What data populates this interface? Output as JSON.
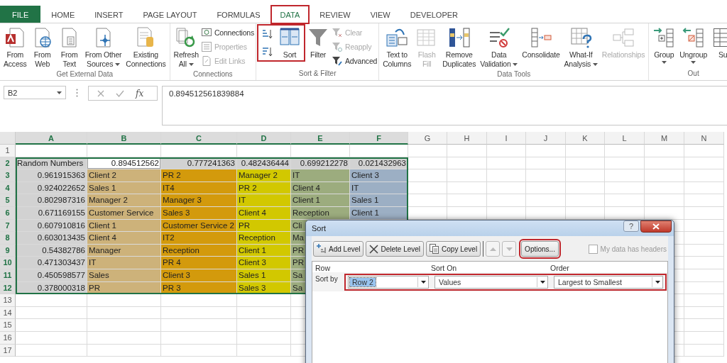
{
  "ribbon_tabs": [
    {
      "label": "FILE",
      "kind": "file",
      "selected": false,
      "highlighted": false
    },
    {
      "label": "HOME",
      "kind": "tab",
      "selected": false,
      "highlighted": false
    },
    {
      "label": "INSERT",
      "kind": "tab",
      "selected": false,
      "highlighted": false
    },
    {
      "label": "PAGE LAYOUT",
      "kind": "tab",
      "selected": false,
      "highlighted": false
    },
    {
      "label": "FORMULAS",
      "kind": "tab",
      "selected": false,
      "highlighted": false
    },
    {
      "label": "DATA",
      "kind": "tab",
      "selected": true,
      "highlighted": true
    },
    {
      "label": "REVIEW",
      "kind": "tab",
      "selected": false,
      "highlighted": false
    },
    {
      "label": "VIEW",
      "kind": "tab",
      "selected": false,
      "highlighted": false
    },
    {
      "label": "DEVELOPER",
      "kind": "tab",
      "selected": false,
      "highlighted": false
    }
  ],
  "ribbon": {
    "groups": [
      {
        "label": "Get External Data",
        "items": [
          {
            "kind": "large",
            "lines": [
              "From",
              "Access"
            ],
            "dropdown": false,
            "disabled": false
          },
          {
            "kind": "large",
            "lines": [
              "From",
              "Web"
            ],
            "dropdown": false,
            "disabled": false
          },
          {
            "kind": "large",
            "lines": [
              "From",
              "Text"
            ],
            "dropdown": false,
            "disabled": false
          },
          {
            "kind": "large",
            "lines": [
              "From Other",
              "Sources"
            ],
            "dropdown": true,
            "disabled": false
          },
          {
            "kind": "large",
            "lines": [
              "Existing",
              "Connections"
            ],
            "dropdown": false,
            "disabled": false
          }
        ]
      },
      {
        "label": "Connections",
        "items": [
          {
            "kind": "large",
            "lines": [
              "Refresh",
              "All"
            ],
            "dropdown": true,
            "disabled": false
          },
          {
            "kind": "stack",
            "items": [
              {
                "kind": "small",
                "label": "Connections",
                "disabled": false
              },
              {
                "kind": "small",
                "label": "Properties",
                "disabled": true
              },
              {
                "kind": "small",
                "label": "Edit Links",
                "disabled": true
              }
            ]
          }
        ]
      },
      {
        "label": "Sort & Filter",
        "items": [
          {
            "kind": "cluster",
            "highlighted": true,
            "items": [
              {
                "kind": "stack",
                "items": [
                  {
                    "kind": "icon",
                    "disabled": false
                  },
                  {
                    "kind": "icon",
                    "disabled": false
                  }
                ]
              },
              {
                "kind": "large",
                "lines": [
                  "Sort"
                ],
                "dropdown": false,
                "disabled": false
              }
            ]
          },
          {
            "kind": "large",
            "lines": [
              "Filter"
            ],
            "dropdown": false,
            "disabled": false
          },
          {
            "kind": "stack",
            "items": [
              {
                "kind": "small",
                "label": "Clear",
                "disabled": true
              },
              {
                "kind": "small",
                "label": "Reapply",
                "disabled": true
              },
              {
                "kind": "small",
                "label": "Advanced",
                "disabled": false
              }
            ]
          }
        ]
      },
      {
        "label": "Data Tools",
        "items": [
          {
            "kind": "large",
            "lines": [
              "Text to",
              "Columns"
            ],
            "dropdown": false,
            "disabled": false
          },
          {
            "kind": "large",
            "lines": [
              "Flash",
              "Fill"
            ],
            "dropdown": false,
            "disabled": true
          },
          {
            "kind": "large",
            "lines": [
              "Remove",
              "Duplicates"
            ],
            "dropdown": false,
            "disabled": false
          },
          {
            "kind": "large",
            "lines": [
              "Data",
              "Validation"
            ],
            "dropdown": true,
            "disabled": false
          },
          {
            "kind": "large",
            "lines": [
              "Consolidate"
            ],
            "dropdown": false,
            "disabled": false
          },
          {
            "kind": "large",
            "lines": [
              "What-If",
              "Analysis"
            ],
            "dropdown": true,
            "disabled": false
          },
          {
            "kind": "large",
            "lines": [
              "Relationships"
            ],
            "dropdown": false,
            "disabled": true
          }
        ]
      },
      {
        "label": "Out",
        "items": [
          {
            "kind": "large",
            "lines": [
              "Group"
            ],
            "dropdown": true,
            "disabled": false
          },
          {
            "kind": "large",
            "lines": [
              "Ungroup"
            ],
            "dropdown": true,
            "disabled": false
          },
          {
            "kind": "large",
            "lines": [
              "Su"
            ],
            "dropdown": false,
            "disabled": false
          }
        ]
      }
    ]
  },
  "formula_bar": {
    "name_box": "B2",
    "insert_function": "fx",
    "formula": "0.894512561839884"
  },
  "sheet": {
    "columns": [
      "A",
      "B",
      "C",
      "D",
      "E",
      "F",
      "G",
      "H",
      "I",
      "J",
      "K",
      "L",
      "M",
      "N"
    ],
    "rows": [
      {
        "label": "1",
        "cells": []
      },
      {
        "label": "2",
        "cells": [
          {
            "text": "Random Numbers",
            "kind": "text",
            "color": "#d2d2d2",
            "selected": false
          },
          {
            "text": "0.894512562",
            "kind": "number",
            "selected": true
          },
          {
            "text": "0.777241363",
            "kind": "number",
            "color": "#d2d2d2",
            "selected": false
          },
          {
            "text": "0.482436444",
            "kind": "number",
            "color": "#d2d2d2",
            "selected": false
          },
          {
            "text": "0.699212278",
            "kind": "number",
            "color": "#d2d2d2",
            "selected": false
          },
          {
            "text": "0.021432963",
            "kind": "number",
            "color": "#d2d2d2",
            "selected": false
          }
        ]
      },
      {
        "label": "3",
        "cells": [
          {
            "text": "0.961915363",
            "kind": "number",
            "color": "#d2d2d2",
            "selected": false
          },
          {
            "text": "Client 2",
            "kind": "text",
            "color": "#cdb27a",
            "selected": false
          },
          {
            "text": "PR 2",
            "kind": "text",
            "color": "#d39a0c",
            "selected": false
          },
          {
            "text": "Manager 2",
            "kind": "text",
            "color": "#d2c800",
            "selected": false
          },
          {
            "text": "IT",
            "kind": "text",
            "color": "#9cac7e",
            "selected": false
          },
          {
            "text": "Client 3",
            "kind": "text",
            "color": "#9cafc4",
            "selected": false
          }
        ]
      },
      {
        "label": "4",
        "cells": [
          {
            "text": "0.924022652",
            "kind": "number",
            "color": "#d2d2d2",
            "selected": false
          },
          {
            "text": "Sales 1",
            "kind": "text",
            "color": "#cdb27a",
            "selected": false
          },
          {
            "text": "IT4",
            "kind": "text",
            "color": "#d39a0c",
            "selected": false
          },
          {
            "text": "PR 2",
            "kind": "text",
            "color": "#d2c800",
            "selected": false
          },
          {
            "text": "Client 4",
            "kind": "text",
            "color": "#9cac7e",
            "selected": false
          },
          {
            "text": "IT",
            "kind": "text",
            "color": "#9cafc4",
            "selected": false
          }
        ]
      },
      {
        "label": "5",
        "cells": [
          {
            "text": "0.802987316",
            "kind": "number",
            "color": "#d2d2d2",
            "selected": false
          },
          {
            "text": "Manager 2",
            "kind": "text",
            "color": "#cdb27a",
            "selected": false
          },
          {
            "text": "Manager 3",
            "kind": "text",
            "color": "#d39a0c",
            "selected": false
          },
          {
            "text": "IT",
            "kind": "text",
            "color": "#d2c800",
            "selected": false
          },
          {
            "text": "Client 1",
            "kind": "text",
            "color": "#9cac7e",
            "selected": false
          },
          {
            "text": "Sales 1",
            "kind": "text",
            "color": "#9cafc4",
            "selected": false
          }
        ]
      },
      {
        "label": "6",
        "cells": [
          {
            "text": "0.671169155",
            "kind": "number",
            "color": "#d2d2d2",
            "selected": false
          },
          {
            "text": "Customer Service",
            "kind": "text",
            "color": "#cdb27a",
            "selected": false
          },
          {
            "text": "Sales 3",
            "kind": "text",
            "color": "#d39a0c",
            "selected": false
          },
          {
            "text": "Client 4",
            "kind": "text",
            "color": "#d2c800",
            "selected": false
          },
          {
            "text": "Reception",
            "kind": "text",
            "color": "#9cac7e",
            "selected": false
          },
          {
            "text": "Client 1",
            "kind": "text",
            "color": "#9cafc4",
            "selected": false
          }
        ]
      },
      {
        "label": "7",
        "cells": [
          {
            "text": "0.607910816",
            "kind": "number",
            "color": "#d2d2d2",
            "selected": false
          },
          {
            "text": "Client 1",
            "kind": "text",
            "color": "#cdb27a",
            "selected": false
          },
          {
            "text": "Customer Service 2",
            "kind": "text",
            "color": "#d39a0c",
            "selected": false
          },
          {
            "text": "PR",
            "kind": "text",
            "color": "#d2c800",
            "selected": false
          },
          {
            "text": "Cli",
            "kind": "text",
            "color": "#9cac7e",
            "selected": false
          }
        ]
      },
      {
        "label": "8",
        "cells": [
          {
            "text": "0.603013435",
            "kind": "number",
            "color": "#d2d2d2",
            "selected": false
          },
          {
            "text": "Client 4",
            "kind": "text",
            "color": "#cdb27a",
            "selected": false
          },
          {
            "text": "IT2",
            "kind": "text",
            "color": "#d39a0c",
            "selected": false
          },
          {
            "text": "Reception",
            "kind": "text",
            "color": "#d2c800",
            "selected": false
          },
          {
            "text": "Ma",
            "kind": "text",
            "color": "#9cac7e",
            "selected": false
          }
        ]
      },
      {
        "label": "9",
        "cells": [
          {
            "text": "0.54382786",
            "kind": "number",
            "color": "#d2d2d2",
            "selected": false
          },
          {
            "text": "Manager",
            "kind": "text",
            "color": "#cdb27a",
            "selected": false
          },
          {
            "text": "Reception",
            "kind": "text",
            "color": "#d39a0c",
            "selected": false
          },
          {
            "text": "Client 1",
            "kind": "text",
            "color": "#d2c800",
            "selected": false
          },
          {
            "text": "PR",
            "kind": "text",
            "color": "#9cac7e",
            "selected": false
          }
        ]
      },
      {
        "label": "10",
        "cells": [
          {
            "text": "0.471303437",
            "kind": "number",
            "color": "#d2d2d2",
            "selected": false
          },
          {
            "text": "IT",
            "kind": "text",
            "color": "#cdb27a",
            "selected": false
          },
          {
            "text": "PR 4",
            "kind": "text",
            "color": "#d39a0c",
            "selected": false
          },
          {
            "text": "Client 3",
            "kind": "text",
            "color": "#d2c800",
            "selected": false
          },
          {
            "text": "PR",
            "kind": "text",
            "color": "#9cac7e",
            "selected": false
          }
        ]
      },
      {
        "label": "11",
        "cells": [
          {
            "text": "0.450598577",
            "kind": "number",
            "color": "#d2d2d2",
            "selected": false
          },
          {
            "text": "Sales",
            "kind": "text",
            "color": "#cdb27a",
            "selected": false
          },
          {
            "text": "Client 3",
            "kind": "text",
            "color": "#d39a0c",
            "selected": false
          },
          {
            "text": "Sales 1",
            "kind": "text",
            "color": "#d2c800",
            "selected": false
          },
          {
            "text": "Sa",
            "kind": "text",
            "color": "#9cac7e",
            "selected": false
          }
        ]
      },
      {
        "label": "12",
        "cells": [
          {
            "text": "0.378000318",
            "kind": "number",
            "color": "#d2d2d2",
            "selected": false
          },
          {
            "text": "PR",
            "kind": "text",
            "color": "#cdb27a",
            "selected": false
          },
          {
            "text": "PR 3",
            "kind": "text",
            "color": "#d39a0c",
            "selected": false
          },
          {
            "text": "Sales 3",
            "kind": "text",
            "color": "#d2c800",
            "selected": false
          },
          {
            "text": "Sa",
            "kind": "text",
            "color": "#9cac7e",
            "selected": false
          }
        ]
      },
      {
        "label": "13",
        "cells": []
      },
      {
        "label": "14",
        "cells": []
      },
      {
        "label": "15",
        "cells": []
      },
      {
        "label": "16",
        "cells": []
      },
      {
        "label": "17",
        "cells": []
      }
    ]
  },
  "sort_dialog": {
    "title": "Sort",
    "help": "?",
    "buttons": [
      {
        "label": "Add Level",
        "kind": "add"
      },
      {
        "label": "Delete Level",
        "kind": "delete"
      },
      {
        "label": "Copy Level",
        "kind": "copy"
      }
    ],
    "move_buttons": [
      {
        "kind": "up",
        "disabled": true
      },
      {
        "kind": "down",
        "disabled": true
      }
    ],
    "options": {
      "label": "Options...",
      "highlighted": true
    },
    "headers_checkbox": {
      "label": "My data has headers",
      "checked": false,
      "disabled": true
    },
    "columns": [
      "Row",
      "Sort On",
      "Order"
    ],
    "levels": [
      {
        "label": "Sort by",
        "row": "Row 2",
        "row_selected": true,
        "sort_on": "Values",
        "order": "Largest to Smallest",
        "highlighted": true
      }
    ]
  }
}
